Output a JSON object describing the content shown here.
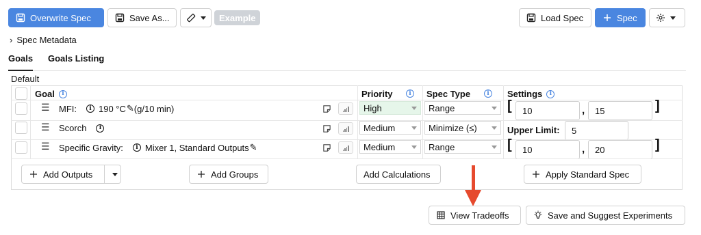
{
  "toolbar": {
    "overwrite_spec": "Overwrite Spec",
    "save_as": "Save As...",
    "example_badge": "Example",
    "load_spec": "Load Spec",
    "add_spec": "Spec"
  },
  "metadata_toggle": "Spec Metadata",
  "tabs": [
    "Goals",
    "Goals Listing"
  ],
  "section_label": "Default",
  "table": {
    "headers": {
      "goal": "Goal",
      "priority": "Priority",
      "spec_type": "Spec Type",
      "settings": "Settings"
    },
    "rows": [
      {
        "goal_label": "MFI:",
        "goal_detail": "190 °C",
        "goal_unit": "(g/10 min)",
        "priority": "High",
        "spec_type": "Range",
        "low": "10",
        "high": "15"
      },
      {
        "goal_label": "Scorch",
        "priority": "Medium",
        "spec_type": "Minimize (≤)",
        "upper_limit_label": "Upper Limit:",
        "upper_limit": "5"
      },
      {
        "goal_label": "Specific Gravity:",
        "goal_detail": "Mixer 1, Standard Outputs",
        "priority": "Medium",
        "spec_type": "Range",
        "low": "10",
        "high": "20"
      }
    ]
  },
  "actions": {
    "add_outputs": "Add Outputs",
    "add_groups": "Add Groups",
    "add_calculations": "Add Calculations",
    "apply_standard_spec": "Apply Standard Spec"
  },
  "footer": {
    "view_tradeoffs": "View Tradeoffs",
    "save_suggest": "Save and Suggest Experiments"
  },
  "colors": {
    "primary": "#4a86e0",
    "annotation_arrow": "#e64a2e",
    "high_priority_bg": "#e6f6ea"
  },
  "icons": [
    "save-icon",
    "ruler-icon",
    "plus-icon",
    "gear-icon",
    "chevron-right-icon",
    "info-icon",
    "drag-handle-icon",
    "note-icon",
    "signal-icon",
    "pencil-icon",
    "grid-icon",
    "lightbulb-icon"
  ]
}
